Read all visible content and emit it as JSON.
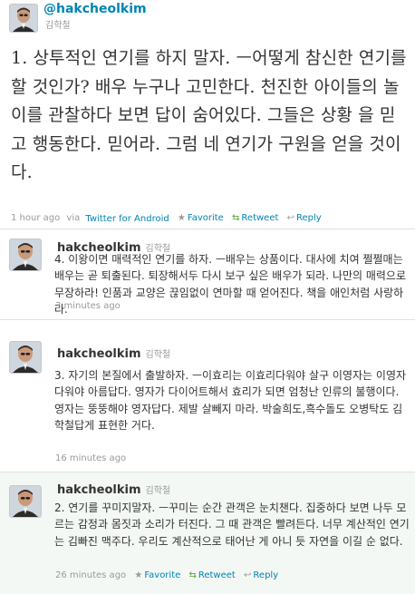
{
  "main": {
    "screen_name": "@hakcheolkim",
    "full_name": "김학철",
    "text": "1. 상투적인 연기를 하지 말자. ㅡ어떻게 참신한 연기를 할 것인가? 배우 누구나 고민한다. 천진한 아이들의 놀이를 관찰하다 보면 답이 숨어있다. 그들은 상황 을 믿고 행동한다. 믿어라. 그럼 네 연기가 구원을 얻을 것이다.",
    "time": "1 hour ago",
    "via_prefix": "via",
    "client": "Twitter for Android",
    "favorite": "Favorite",
    "retweet": "Retweet",
    "reply": "Reply"
  },
  "tweets": [
    {
      "screen_name": "hakcheolkim",
      "full_name": "김학철",
      "text": "4. 이왕이면 매력적인 연기를 하자. ㅡ배우는 상품이다. 대사에 치여 쩔쩔매는 배우는 곧 퇴출된다. 퇴장해서두 다시 보구 싶은 배우가 되라. 나만의 매력으로 무장하라! 인품과 교양은 끊임없이 연마할 때 얻어진다. 책을 애인처럼 사랑하라.",
      "time": "3 minutes ago"
    },
    {
      "screen_name": "hakcheolkim",
      "full_name": "김학철",
      "text": "3. 자기의 본질에서 출발하자. ㅡ이효리는 이효리다워야 살구 이영자는 이영자다워야 아름답다. 영자가 다이어트해서 효리가 되면 엄청난 인류의 불행이다. 영자는 뚱뚱해야 영자답다. 제발 살빼지 마라. 박술희도,흑수돌도 오병탁도 김학철답게 표현한 거다.",
      "time": "16 minutes ago"
    },
    {
      "screen_name": "hakcheolkim",
      "full_name": "김학철",
      "text": "2. 연기를 꾸미지말자. ㅡ꾸미는 순간 관객은 눈치챈다. 집중하다 보면 나두 모르는 감정과 몸짓과 소리가 터진다. 그 때 관객은 빨려든다. 너무 계산적인 연기는 김빠진 맥주다. 우리도 계산적으로 태어난 게 아니 듯 자연을 이길 순 없다.",
      "time": "26 minutes ago",
      "favorite": "Favorite",
      "retweet": "Retweet",
      "reply": "Reply"
    }
  ],
  "icons": {
    "favorite": "star-icon",
    "retweet": "retweet-icon",
    "reply": "reply-icon"
  },
  "colors": {
    "link": "#0084b4",
    "muted": "#999999",
    "text": "#333333",
    "hover_bg": "#f4f8f4",
    "retweet_green": "#5ea13d"
  }
}
